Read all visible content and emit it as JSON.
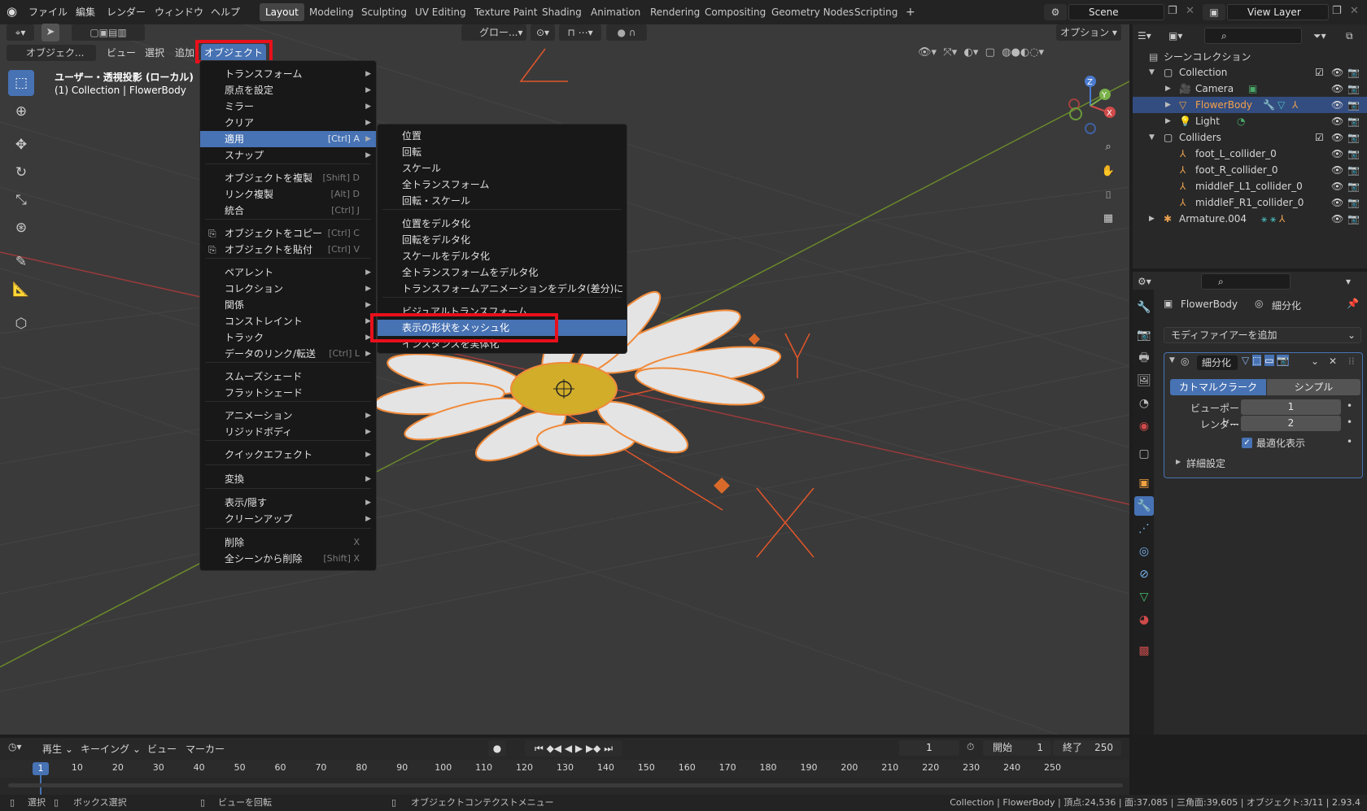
{
  "app_menu": {
    "file": "ファイル",
    "edit": "編集",
    "render": "レンダー",
    "window": "ウィンドウ",
    "help": "ヘルプ"
  },
  "workspaces": [
    "Layout",
    "Modeling",
    "Sculpting",
    "UV Editing",
    "Texture Paint",
    "Shading",
    "Animation",
    "Rendering",
    "Compositing",
    "Geometry Nodes",
    "Scripting"
  ],
  "workspace_add": "+",
  "scene": "Scene",
  "view_layer": "View Layer",
  "viewport": {
    "header": {
      "mode": "オブジェク...",
      "view": "ビュー",
      "select": "選択",
      "add": "追加",
      "object": "オブジェクト",
      "transform_orientation": "グロー...",
      "options": "オプション"
    },
    "info_title": "ユーザー・透視投影 (ローカル)",
    "info_sub": "(1) Collection | FlowerBody",
    "axis_x": "X",
    "axis_y": "Y",
    "axis_z": "Z"
  },
  "object_menu": {
    "items": [
      {
        "label": "トランスフォーム",
        "shortcut": "",
        "submenu": true
      },
      {
        "label": "原点を設定",
        "shortcut": "",
        "submenu": true
      },
      {
        "label": "ミラー",
        "shortcut": "",
        "submenu": true
      },
      {
        "label": "クリア",
        "shortcut": "",
        "submenu": true
      },
      {
        "label": "適用",
        "shortcut": "[Ctrl] A",
        "submenu": true
      },
      {
        "label": "スナップ",
        "shortcut": "",
        "submenu": true
      },
      {
        "label": "オブジェクトを複製",
        "shortcut": "[Shift] D",
        "submenu": false
      },
      {
        "label": "リンク複製",
        "shortcut": "[Alt] D",
        "submenu": false
      },
      {
        "label": "統合",
        "shortcut": "[Ctrl] J",
        "submenu": false
      },
      {
        "label": "オブジェクトをコピー",
        "shortcut": "[Ctrl] C",
        "submenu": false
      },
      {
        "label": "オブジェクトを貼付",
        "shortcut": "[Ctrl] V",
        "submenu": false
      },
      {
        "label": "ペアレント",
        "shortcut": "",
        "submenu": true
      },
      {
        "label": "コレクション",
        "shortcut": "",
        "submenu": true
      },
      {
        "label": "関係",
        "shortcut": "",
        "submenu": true
      },
      {
        "label": "コンストレイント",
        "shortcut": "",
        "submenu": true
      },
      {
        "label": "トラック",
        "shortcut": "",
        "submenu": true
      },
      {
        "label": "データのリンク/転送",
        "shortcut": "[Ctrl] L",
        "submenu": true
      },
      {
        "label": "スムーズシェード",
        "shortcut": "",
        "submenu": false
      },
      {
        "label": "フラットシェード",
        "shortcut": "",
        "submenu": false
      },
      {
        "label": "アニメーション",
        "shortcut": "",
        "submenu": true
      },
      {
        "label": "リジッドボディ",
        "shortcut": "",
        "submenu": true
      },
      {
        "label": "クイックエフェクト",
        "shortcut": "",
        "submenu": true
      },
      {
        "label": "変換",
        "shortcut": "",
        "submenu": true
      },
      {
        "label": "表示/隠す",
        "shortcut": "",
        "submenu": true
      },
      {
        "label": "クリーンアップ",
        "shortcut": "",
        "submenu": true
      },
      {
        "label": "削除",
        "shortcut": "X",
        "submenu": false
      },
      {
        "label": "全シーンから削除",
        "shortcut": "[Shift] X",
        "submenu": false
      }
    ]
  },
  "apply_submenu": {
    "items": [
      "位置",
      "回転",
      "スケール",
      "全トランスフォーム",
      "回転・スケール",
      "位置をデルタ化",
      "回転をデルタ化",
      "スケールをデルタ化",
      "全トランスフォームをデルタ化",
      "トランスフォームアニメーションをデルタ(差分)に",
      "ビジュアルトランスフォーム",
      "表示の形状をメッシュ化",
      "インスタンスを実体化"
    ]
  },
  "outliner": {
    "root": "シーンコレクション",
    "rows": [
      {
        "label": "Collection"
      },
      {
        "label": "Camera"
      },
      {
        "label": "FlowerBody"
      },
      {
        "label": "Light"
      },
      {
        "label": "Colliders"
      },
      {
        "label": "foot_L_collider_0"
      },
      {
        "label": "foot_R_collider_0"
      },
      {
        "label": "middleF_L1_collider_0"
      },
      {
        "label": "middleF_R1_collider_0"
      },
      {
        "label": "Armature.004"
      }
    ]
  },
  "properties": {
    "object_name": "FlowerBody",
    "modifier_name_header": "細分化",
    "add_modifier": "モディファイアーを追加",
    "modifier_name": "細分化",
    "tab_catmull": "カトマルクラーク",
    "tab_simple": "シンプル",
    "viewport_label": "ビューポート...",
    "viewport_value": "1",
    "render_label": "レンダー",
    "render_value": "2",
    "optimal_label": "最適化表示",
    "advanced": "詳細設定"
  },
  "timeline": {
    "playback": "再生",
    "keying": "キーイング",
    "view": "ビュー",
    "marker": "マーカー",
    "current_frame": "1",
    "start_label": "開始",
    "start": "1",
    "end_label": "終了",
    "end": "250",
    "ticks": [
      "1",
      "10",
      "20",
      "30",
      "40",
      "50",
      "60",
      "70",
      "80",
      "90",
      "100",
      "110",
      "120",
      "130",
      "140",
      "150",
      "160",
      "170",
      "180",
      "190",
      "200",
      "210",
      "220",
      "230",
      "240",
      "250"
    ]
  },
  "status": {
    "select": "選択",
    "box_select": "ボックス選択",
    "rotate_view": "ビューを回転",
    "context_menu": "オブジェクトコンテクストメニュー",
    "stats": "Collection | FlowerBody | 頂点:24,536 | 面:37,085 | 三角面:39,605 | オブジェクト:3/11 | 2.93.4"
  },
  "colors": {
    "accent": "#4772b3",
    "highlight_red": "#e8101b",
    "selected_orange": "#f08a3a"
  }
}
